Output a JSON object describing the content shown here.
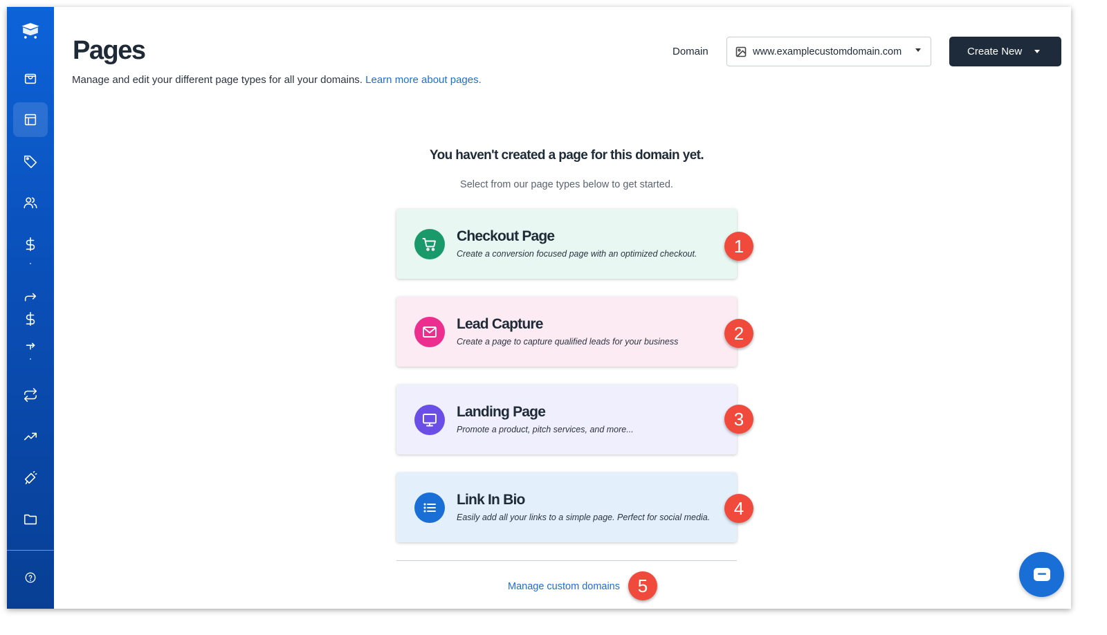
{
  "header": {
    "title": "Pages",
    "subtitle": "Manage and edit your different page types for all your domains.",
    "learn_more": "Learn more about pages.",
    "domain_label": "Domain",
    "domain_value": "www.examplecustomdomain.com",
    "create_button": "Create New"
  },
  "empty_state": {
    "title": "You haven't created a page for this domain yet.",
    "subtitle": "Select from our page types below to get started."
  },
  "cards": [
    {
      "title": "Checkout Page",
      "description": "Create a conversion focused page with an optimized checkout.",
      "icon": "cart-icon",
      "bg": "#e8f7f1",
      "icon_color": "#1a9a6a",
      "badge": "1"
    },
    {
      "title": "Lead Capture",
      "description": "Create a page to capture qualified leads for your business",
      "icon": "mail-icon",
      "bg": "#fdebf4",
      "icon_color": "#ec2f8e",
      "badge": "2"
    },
    {
      "title": "Landing Page",
      "description": "Promote a product, pitch services, and more...",
      "icon": "monitor-icon",
      "bg": "#f0effd",
      "icon_color": "#6a4ee6",
      "badge": "3"
    },
    {
      "title": "Link In Bio",
      "description": "Easily add all your links to a simple page. Perfect for social media.",
      "icon": "list-icon",
      "bg": "#e3f0fc",
      "icon_color": "#1a6fd6",
      "badge": "4"
    }
  ],
  "footer": {
    "manage_link": "Manage custom domains",
    "badge": "5"
  },
  "colors": {
    "sidebar": "#0a4fb8",
    "primary_dark": "#1d2b3a",
    "link": "#1a6fd6",
    "badge": "#ef4a3c"
  }
}
